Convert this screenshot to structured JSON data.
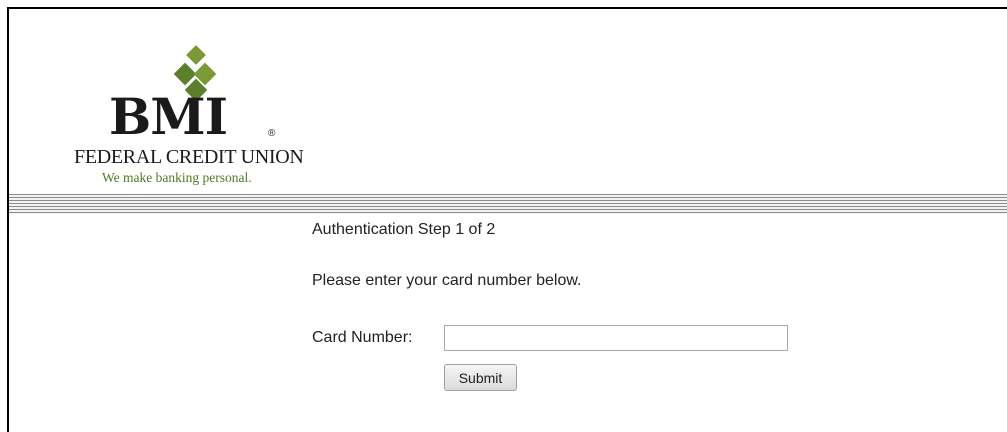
{
  "logo": {
    "brand": "BMI",
    "registered_mark": "®",
    "name": "Federal Credit Union",
    "name_display": "FEDERAL CREDIT UNION",
    "tagline": "We make banking personal."
  },
  "auth": {
    "step_text": "Authentication Step 1 of 2",
    "instruction": "Please enter your card number below.",
    "card_label": "Card Number:",
    "card_value": "",
    "submit_label": "Submit"
  },
  "colors": {
    "brand_green": "#5b7f2a",
    "light_green": "#7a9a35",
    "tagline_green": "#4e7a22",
    "stripe_gray": "#8c8c8c"
  }
}
